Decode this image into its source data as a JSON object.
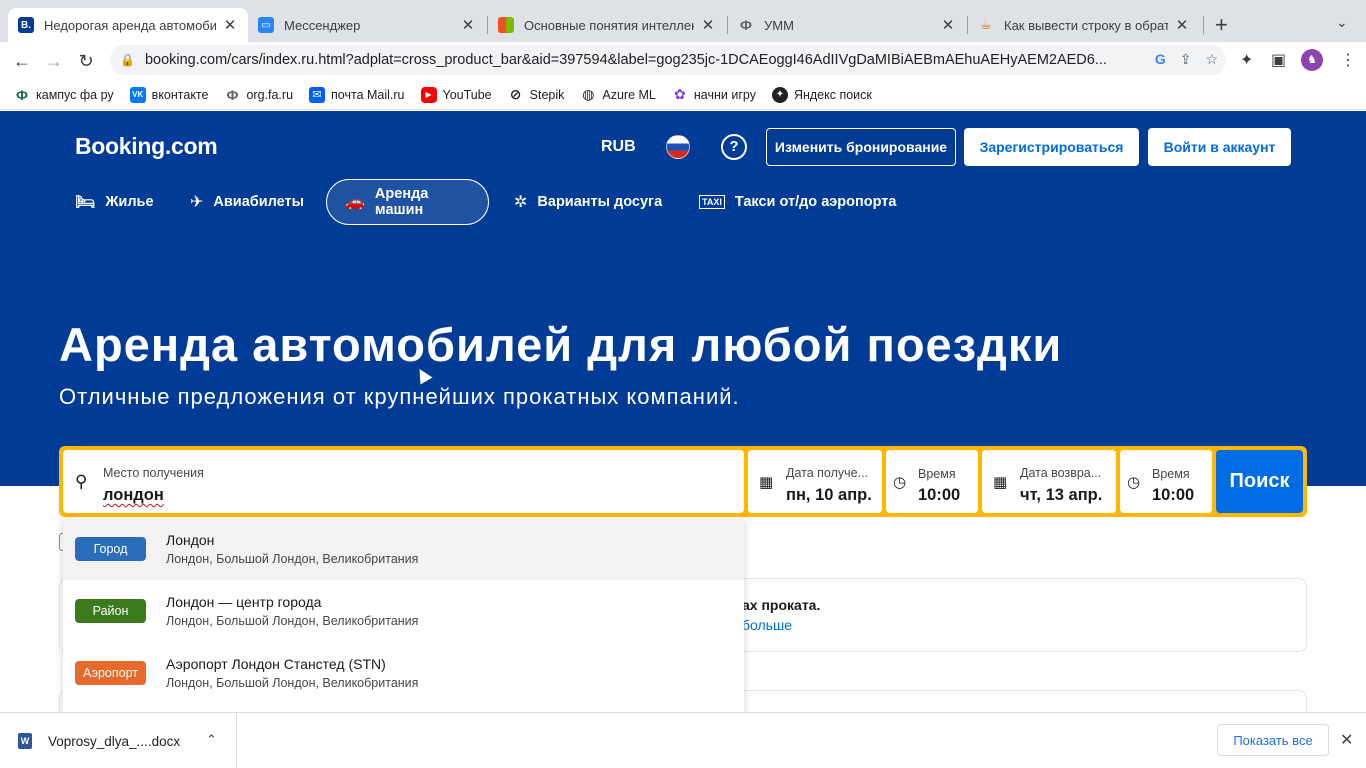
{
  "browser": {
    "tabs": [
      {
        "title": "Недорогая аренда автомобил",
        "favicon": "B.",
        "favicon_color": "#003b95",
        "active": true
      },
      {
        "title": "Мессенджер",
        "favicon": "chat-icon",
        "favicon_color": "#2787f5",
        "active": false
      },
      {
        "title": "Основные понятия интеллект",
        "favicon": "microsoft-icon",
        "favicon_color": "#f25022",
        "active": false
      },
      {
        "title": "УММ",
        "favicon": "Ф",
        "favicon_color": "#5f6368",
        "active": false
      },
      {
        "title": "Как вывести строку в обратн",
        "favicon": "java-icon",
        "favicon_color": "#e76f00",
        "active": false
      }
    ],
    "url": "booking.com/cars/index.ru.html?adplat=cross_product_bar&aid=397594&label=gog235jc-1DCAEoggI46AdIIVgDaMIBiAEBmAEhuAEHyAEM2AED6...",
    "bookmarks": [
      {
        "label": "кампус фа ру",
        "icon": "Ф",
        "color": "#0b6e4f"
      },
      {
        "label": "вконтакте",
        "icon": "vk-icon",
        "color": "#0077ff"
      },
      {
        "label": "org.fa.ru",
        "icon": "Ф",
        "color": "#5f6368"
      },
      {
        "label": "почта Mail.ru",
        "icon": "mail-icon",
        "color": "#005ff9"
      },
      {
        "label": "YouTube",
        "icon": "youtube-icon",
        "color": "#ff0000"
      },
      {
        "label": "Stepik",
        "icon": "stepik-icon",
        "color": "#202124"
      },
      {
        "label": "Azure ML",
        "icon": "globe-icon",
        "color": "#202124"
      },
      {
        "label": "начни игру",
        "icon": "game-icon",
        "color": "#7b3fe4"
      },
      {
        "label": "Яндекс поиск",
        "icon": "yandex-icon",
        "color": "#202124"
      }
    ]
  },
  "header": {
    "logo": "Booking.com",
    "currency": "RUB",
    "help": "?",
    "manage_booking": "Изменить бронирование",
    "register": "Зарегистрироваться",
    "sign_in": "Войти в аккаунт"
  },
  "nav": [
    {
      "label": "Жилье",
      "icon": "bed-icon",
      "selected": false
    },
    {
      "label": "Авиабилеты",
      "icon": "plane-icon",
      "selected": false
    },
    {
      "label": "Аренда машин",
      "icon": "car-icon",
      "selected": true
    },
    {
      "label": "Варианты досуга",
      "icon": "attractions-icon",
      "selected": false
    },
    {
      "label": "Такси от/до аэропорта",
      "icon": "taxi-icon",
      "selected": false
    }
  ],
  "hero": {
    "title": "Аренда автомобилей для любой поездки",
    "subtitle": "Отличные предложения от крупнейших прокатных компаний."
  },
  "search": {
    "location_label": "Место получения",
    "location_value": "лондон",
    "pickup_date_label": "Дата получе...",
    "pickup_date": "пн, 10 апр.",
    "pickup_time_label": "Время",
    "pickup_time": "10:00",
    "dropoff_date_label": "Дата возвра...",
    "dropoff_date": "чт, 13 апр.",
    "dropoff_time_label": "Время",
    "dropoff_time": "10:00",
    "button": "Поиск"
  },
  "suggestions": [
    {
      "badge": "Город",
      "badge_color": "#2a6ebb",
      "title": "Лондон",
      "subtitle": "Лондон, Большой Лондон, Великобритания"
    },
    {
      "badge": "Район",
      "badge_color": "#3c7a1e",
      "title": "Лондон — центр города",
      "subtitle": "Лондон, Большой Лондон, Великобритания"
    },
    {
      "badge": "Аэропорт",
      "badge_color": "#e56a2b",
      "title": "Аэропорт Лондон Станстед (STN)",
      "subtitle": "Лондон, Большой Лондон, Великобритания"
    }
  ],
  "info": {
    "text": "ах проката.",
    "link": "больше"
  },
  "downloads": {
    "file": "Voprosy_dlya_....docx",
    "show_all": "Показать все"
  },
  "colors": {
    "brand_blue": "#003b95",
    "search_yellow": "#ffb700",
    "action_blue": "#006ce4"
  }
}
